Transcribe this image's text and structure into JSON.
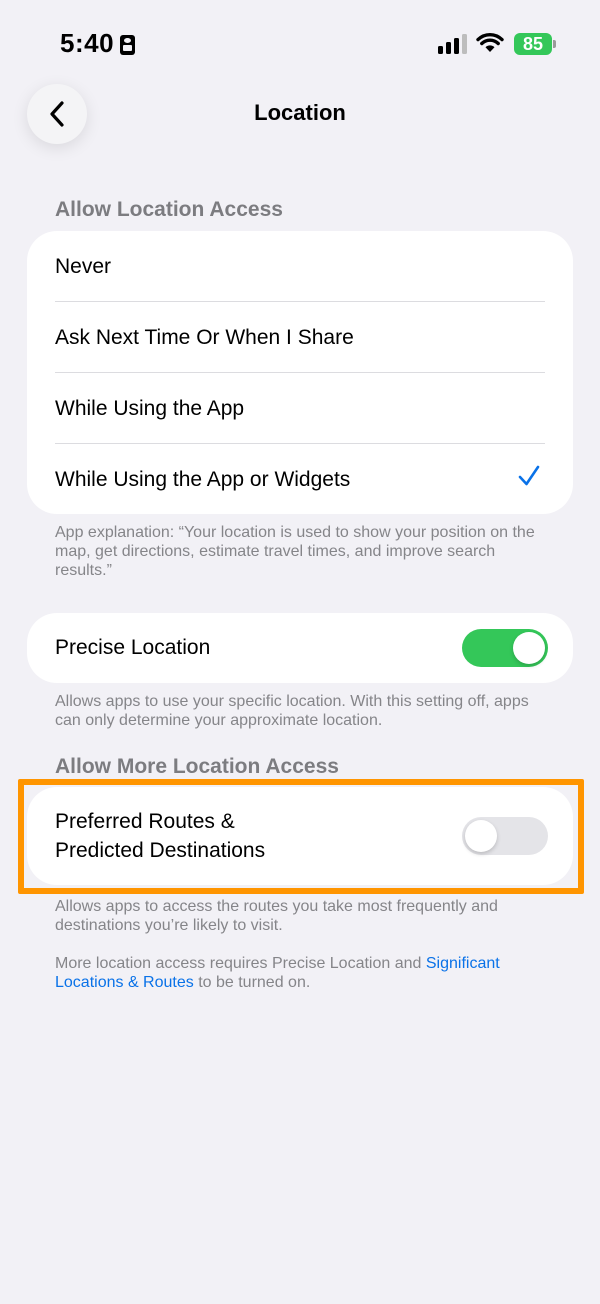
{
  "status_bar": {
    "time": "5:40",
    "battery": "85"
  },
  "nav": {
    "title": "Location",
    "back_icon": "chevron-left-icon"
  },
  "allow_access": {
    "header": "Allow Location Access",
    "options": [
      {
        "label": "Never",
        "selected": false
      },
      {
        "label": "Ask Next Time Or When I Share",
        "selected": false
      },
      {
        "label": "While Using the App",
        "selected": false
      },
      {
        "label": "While Using the App or Widgets",
        "selected": true
      }
    ],
    "footnote": "App explanation: “Your location is used to show your position on the map, get directions, estimate travel times, and improve search results.”"
  },
  "precise_location": {
    "label": "Precise Location",
    "enabled": true,
    "footnote": "Allows apps to use your specific location. With this setting off, apps can only determine your approximate location."
  },
  "more_access": {
    "header": "Allow More Location Access",
    "routes_label_line1": "Preferred Routes &",
    "routes_label_line2": "Predicted Destinations",
    "routes_enabled": false,
    "footnote": "Allows apps to access the routes you take most frequently and destinations you’re likely to visit.",
    "note_prefix": "More location access requires Precise Location and ",
    "note_link": "Significant Locations & Routes",
    "note_suffix": " to be turned on."
  },
  "colors": {
    "accent": "#0a72e8",
    "toggle_on": "#34c759",
    "highlight": "#ff9500",
    "background": "#f2f1f6"
  }
}
